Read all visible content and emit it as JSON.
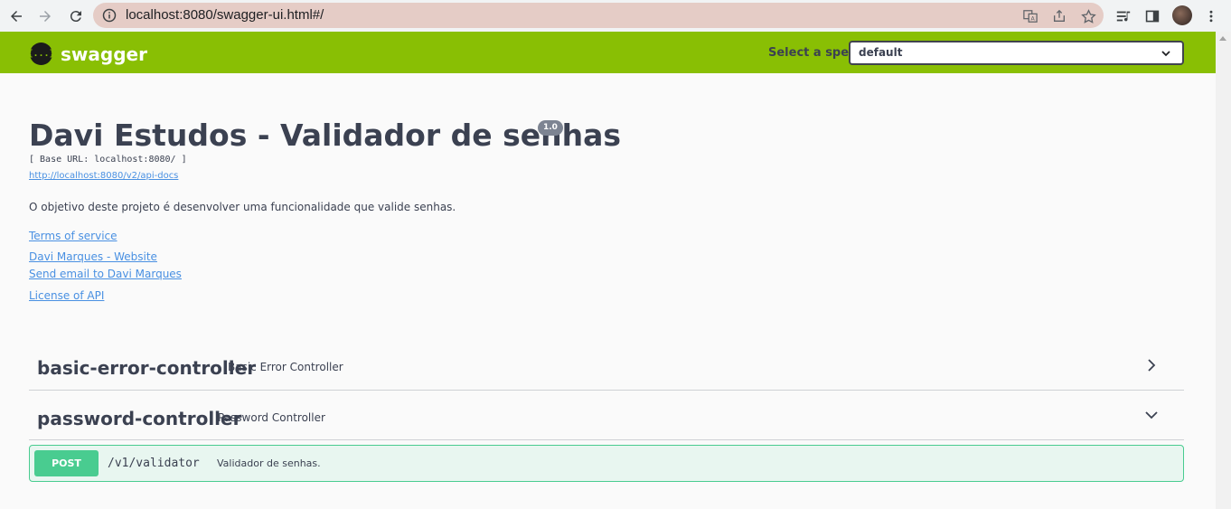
{
  "browser": {
    "url": "localhost:8080/swagger-ui.html#/"
  },
  "topbar": {
    "logo_text": "swagger",
    "logo_symbol": "{...}",
    "spec_label": "Select a spec",
    "spec_value": "default",
    "brand_color": "#89bf04"
  },
  "info": {
    "title": "Davi Estudos - Validador de senhas",
    "version": "1.0",
    "base_url": "[ Base URL: localhost:8080/ ]",
    "api_docs": "http://localhost:8080/v2/api-docs",
    "description": "O objetivo deste projeto é desenvolver uma funcionalidade que valide senhas.",
    "terms": "Terms of service",
    "website": "Davi Marques - Website",
    "email": "Send email to Davi Marques",
    "license": "License of API"
  },
  "tags": [
    {
      "name": "basic-error-controller",
      "description": "Basic Error Controller",
      "expanded": false
    },
    {
      "name": "password-controller",
      "description": "Password Controller",
      "expanded": true
    }
  ],
  "operations": [
    {
      "method": "POST",
      "path": "/v1/validator",
      "summary": "Validador de senhas.",
      "color": "#49cc90"
    }
  ]
}
